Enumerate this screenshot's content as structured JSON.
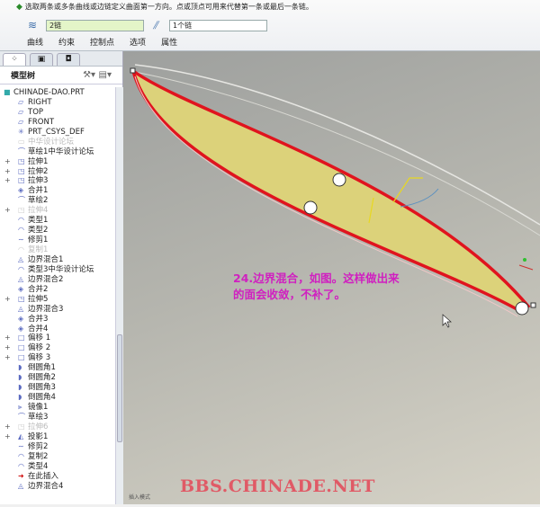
{
  "dashboard": {
    "prompt": "选取两条或多条曲线或边链定义曲面第一方向。点或顶点可用来代替第一条或最后一条链。",
    "first_direction_field": "2链",
    "second_direction_field": "1个链",
    "tabs": [
      "曲线",
      "约束",
      "控制点",
      "选项",
      "属性"
    ]
  },
  "model_tree": {
    "title": "模型树",
    "root": "CHINADE-DAO.PRT",
    "items": [
      {
        "label": "RIGHT",
        "icon": "plane-icon",
        "gray": false,
        "expand": false
      },
      {
        "label": "TOP",
        "icon": "plane-icon",
        "gray": false,
        "expand": false
      },
      {
        "label": "FRONT",
        "icon": "plane-icon",
        "gray": false,
        "expand": false
      },
      {
        "label": "PRT_CSYS_DEF",
        "icon": "csys-icon",
        "gray": false,
        "expand": false
      },
      {
        "label": "中华设计论坛",
        "icon": "note-icon",
        "gray": true,
        "expand": false
      },
      {
        "label": "草绘1中华设计论坛",
        "icon": "sketch-icon",
        "gray": false,
        "expand": false
      },
      {
        "label": "拉伸1",
        "icon": "extrude-icon",
        "gray": false,
        "expand": true
      },
      {
        "label": "拉伸2",
        "icon": "extrude-icon",
        "gray": false,
        "expand": true
      },
      {
        "label": "拉伸3",
        "icon": "extrude-icon",
        "gray": false,
        "expand": true
      },
      {
        "label": "合并1",
        "icon": "merge-icon",
        "gray": false,
        "expand": false
      },
      {
        "label": "草绘2",
        "icon": "sketch-icon",
        "gray": false,
        "expand": false
      },
      {
        "label": "拉伸4",
        "icon": "extrude-icon",
        "gray": true,
        "expand": true
      },
      {
        "label": "类型1",
        "icon": "surface-icon",
        "gray": false,
        "expand": false
      },
      {
        "label": "类型2",
        "icon": "surface-icon",
        "gray": false,
        "expand": false
      },
      {
        "label": "修剪1",
        "icon": "trim-icon",
        "gray": false,
        "expand": false
      },
      {
        "label": "复制1",
        "icon": "copy-icon",
        "gray": true,
        "expand": false
      },
      {
        "label": "边界混合1",
        "icon": "blend-icon",
        "gray": false,
        "expand": false
      },
      {
        "label": "类型3中华设计论坛",
        "icon": "surface-icon",
        "gray": false,
        "expand": false
      },
      {
        "label": "边界混合2",
        "icon": "blend-icon",
        "gray": false,
        "expand": false
      },
      {
        "label": "合并2",
        "icon": "merge-icon",
        "gray": false,
        "expand": false
      },
      {
        "label": "拉伸5",
        "icon": "extrude-icon",
        "gray": false,
        "expand": true
      },
      {
        "label": "边界混合3",
        "icon": "blend-icon",
        "gray": false,
        "expand": false
      },
      {
        "label": "合并3",
        "icon": "merge-icon",
        "gray": false,
        "expand": false
      },
      {
        "label": "合并4",
        "icon": "merge-icon",
        "gray": false,
        "expand": false
      },
      {
        "label": "偏移 1",
        "icon": "offset-icon",
        "gray": false,
        "expand": true
      },
      {
        "label": "偏移 2",
        "icon": "offset-icon",
        "gray": false,
        "expand": true
      },
      {
        "label": "偏移 3",
        "icon": "offset-icon",
        "gray": false,
        "expand": true
      },
      {
        "label": "倒圆角1",
        "icon": "round-icon",
        "gray": false,
        "expand": false
      },
      {
        "label": "倒圆角2",
        "icon": "round-icon",
        "gray": false,
        "expand": false
      },
      {
        "label": "倒圆角3",
        "icon": "round-icon",
        "gray": false,
        "expand": false
      },
      {
        "label": "倒圆角4",
        "icon": "round-icon",
        "gray": false,
        "expand": false
      },
      {
        "label": "镜像1",
        "icon": "mirror-icon",
        "gray": false,
        "expand": false
      },
      {
        "label": "草绘3",
        "icon": "sketch-icon",
        "gray": false,
        "expand": false
      },
      {
        "label": "拉伸6",
        "icon": "extrude-icon",
        "gray": true,
        "expand": true
      },
      {
        "label": "投影1",
        "icon": "project-icon",
        "gray": false,
        "expand": true
      },
      {
        "label": "修剪2",
        "icon": "trim-icon",
        "gray": false,
        "expand": false
      },
      {
        "label": "复制2",
        "icon": "copy-icon",
        "gray": false,
        "expand": false
      },
      {
        "label": "类型4",
        "icon": "surface-icon",
        "gray": false,
        "expand": false
      },
      {
        "label": "在此插入",
        "icon": "insert-here-icon",
        "gray": false,
        "expand": false
      },
      {
        "label": "边界混合4",
        "icon": "blend-icon",
        "gray": false,
        "expand": false
      }
    ]
  },
  "canvas": {
    "annotation_line1": "24.边界混合，如图。这样做出来",
    "annotation_line2": "的面会收敛，不补了。",
    "watermark": "BBS.CHINADE.NET",
    "mode_text": "插入模式"
  },
  "colors": {
    "surface": "#dcd27a",
    "chain": "#e0141e",
    "annotation": "#d020c0",
    "watermark": "#e05a66"
  }
}
